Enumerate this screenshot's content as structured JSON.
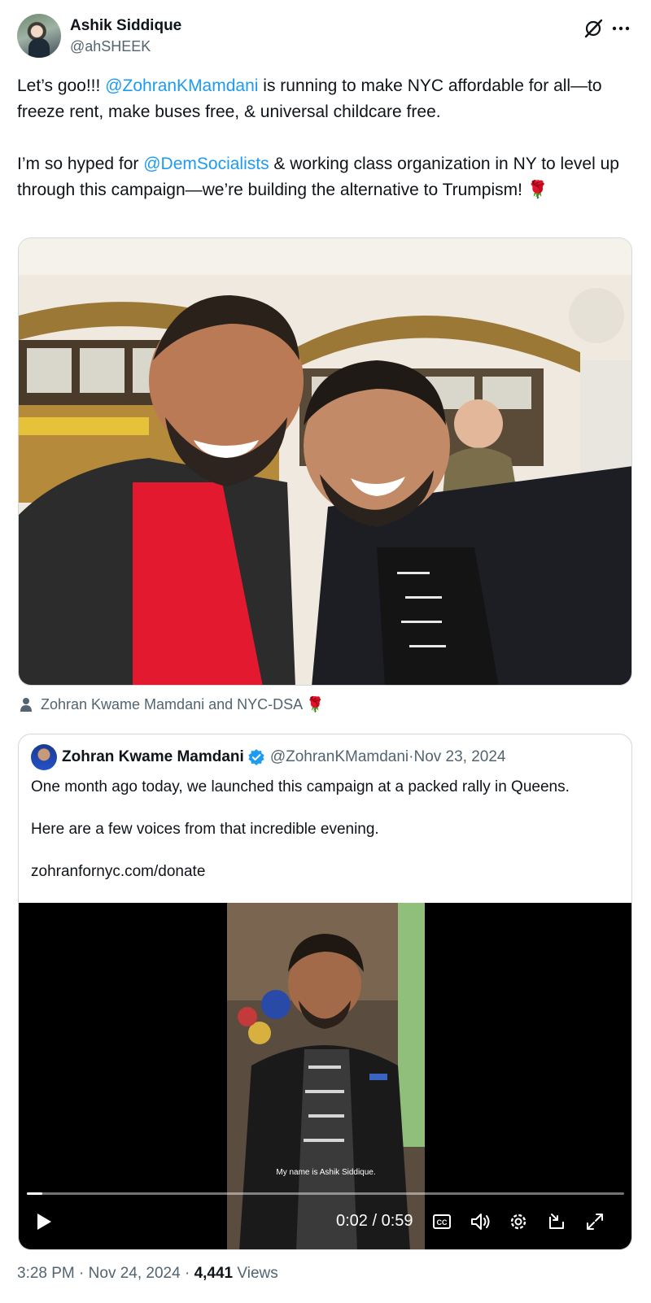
{
  "author": {
    "name": "Ashik Siddique",
    "handle": "@ahSHEEK"
  },
  "tweet": {
    "line1_prefix": "Let’s goo!!! ",
    "line1_mention": "@ZohranKMamdani",
    "line1_suffix": " is running to make NYC affordable for all—to freeze rent, make buses free, & universal childcare free.",
    "line2_prefix": "I’m so hyped for ",
    "line2_mention": "@DemSocialists",
    "line2_suffix": " & working class organization in NY to level up through this campaign—we’re building the alternative to Trumpism! 🌹"
  },
  "tagged": {
    "text": "Zohran Kwame Mamdani and NYC-DSA 🌹"
  },
  "quote": {
    "name": "Zohran Kwame Mamdani",
    "handle": "@ZohranKMamdani",
    "separator": " · ",
    "date": "Nov 23, 2024",
    "para1": "One month ago today, we launched this campaign at a packed rally in Queens.",
    "para2": "Here are a few voices from that incredible evening.",
    "para3": "zohranfornyc.com/donate"
  },
  "video": {
    "caption": "My name is Ashik Siddique.",
    "time": "0:02 / 0:59",
    "progress": 0.026
  },
  "footer": {
    "time": "3:28 PM",
    "sep": " · ",
    "date": "Nov 24, 2024",
    "views_count": "4,441",
    "views_label": " Views"
  },
  "icons": {
    "grok": "grok-icon",
    "more": "more-icon",
    "person": "person-icon",
    "verified": "verified-icon",
    "play": "play-icon",
    "captions": "captions-icon",
    "volume": "volume-icon",
    "settings": "settings-icon",
    "pip": "pip-icon",
    "fullscreen": "fullscreen-icon"
  },
  "colors": {
    "accent": "#1d9bf0",
    "text": "#0f1419",
    "secondary": "#536471"
  }
}
